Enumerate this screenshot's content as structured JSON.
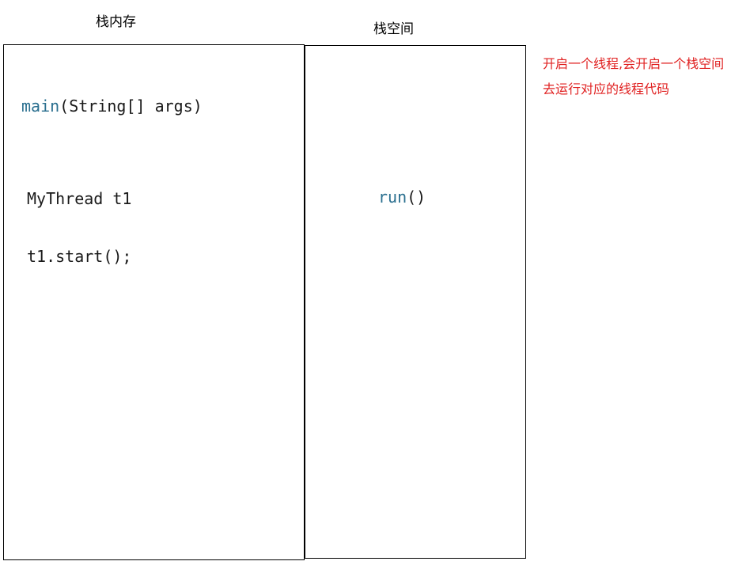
{
  "stack_memory": {
    "title": "栈内存",
    "line_main_name": "main",
    "line_main_params": "(String[] args)",
    "line_declare": "MyThread t1",
    "line_start": "t1.start();"
  },
  "stack_space": {
    "title": "栈空间",
    "line_run_name": "run",
    "line_run_parens": "()"
  },
  "annotation": {
    "line1": "开启一个线程,会开启一个栈空间",
    "line2": "去运行对应的线程代码",
    "color": "#e02020"
  },
  "colors": {
    "keyword": "#2a6f8f",
    "border": "#000000"
  }
}
